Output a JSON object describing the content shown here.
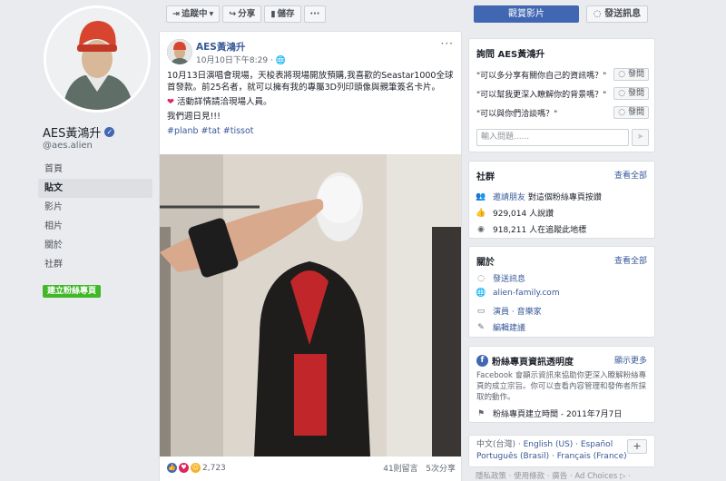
{
  "profile": {
    "name": "AES黃鴻升",
    "username": "@aes.alien",
    "verified_badge": "✓",
    "nav": [
      "首頁",
      "貼文",
      "影片",
      "相片",
      "關於",
      "社群"
    ],
    "create_page": "建立粉絲專頁"
  },
  "toolbar": {
    "following": "追蹤中",
    "share": "分享",
    "save": "儲存",
    "more": "···"
  },
  "actions": {
    "watch_video": "觀賞影片",
    "send_message": "發送訊息"
  },
  "post": {
    "author": "AES黃鴻升",
    "time": "10月10日下午8:29 · ",
    "globe": "🌐",
    "more": "···",
    "line1": "10月13日演唱會現場，天梭表將現場開放預購,我喜歡的Seastar1000全球首發款。前25名者，就可以擁有我的專屬3D列印頭像與親筆簽名卡片。",
    "line2_heart": "❤",
    "line2": "活動詳情請洽現場人員。",
    "line3": "我們週日見!!!",
    "hashtags": "#planb #tat #tissot",
    "reactions_count": "2,723",
    "comments": "41則留言",
    "shares": "5次分享"
  },
  "ask": {
    "title": "詢問 AES黃鴻升",
    "questions": [
      {
        "text": "\"可以多分享有關你自己的資訊嗎？\"",
        "button": "發問"
      },
      {
        "text": "\"可以幫我更深入瞭解你的背景嗎？\"",
        "button": "發問"
      },
      {
        "text": "\"可以與你們洽談嗎？\"",
        "button": "發問"
      }
    ],
    "input_placeholder": "輸入問題......",
    "send": "➤"
  },
  "community": {
    "title": "社群",
    "see_all": "查看全部",
    "invite": "邀請朋友",
    "invite_suffix": "對這個粉絲專頁按讚",
    "likes": "929,014 人說讚",
    "follows": "918,211 人在追蹤此地標"
  },
  "about": {
    "title": "關於",
    "see_all": "查看全部",
    "message": "發送訊息",
    "website": "alien-family.com",
    "category": "演員 · 音樂家",
    "edit": "編輯建議"
  },
  "transparency": {
    "title": "粉絲專頁資訊透明度",
    "see_more": "顯示更多",
    "text": "Facebook 會顯示資訊來協助你更深入瞭解粉絲專頁的成立宗旨。你可以查看內容管理和發佈者所採取的動作。",
    "created": "粉絲專頁建立時間 - 2011年7月7日"
  },
  "languages": {
    "current": "中文(台灣) · ",
    "english": "English (US) · ",
    "spanish": "Español",
    "portuguese": "Português (Brasil) · ",
    "french": "Français (France)",
    "plus": "+"
  },
  "footer": "隱私政策 · 使用條款 · 廣告 · Ad Choices ▷ ·",
  "colors": {
    "accent": "#4267b2",
    "link": "#385898",
    "green": "#42b72a",
    "background": "#e9ebee"
  }
}
